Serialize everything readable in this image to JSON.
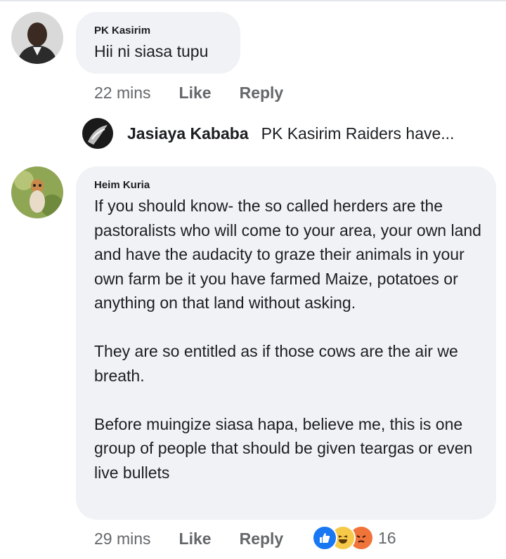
{
  "comments": [
    {
      "author": "PK Kasirim",
      "text": "Hii ni siasa tupu",
      "time": "22 mins",
      "like_label": "Like",
      "reply_label": "Reply"
    },
    {
      "author": "Heim Kuria",
      "text": "If you should know- the so called herders are the pastoralists who will come to your area, your own land and have the audacity to graze their animals in your own farm be it you have farmed Maize, potatoes or anything on that land without asking.\n\nThey are so entitled as if those cows are the air we breath.\n\nBefore muingize siasa hapa, believe me, this is one group of people that should be given teargas or even live bullets",
      "time": "29 mins",
      "like_label": "Like",
      "reply_label": "Reply",
      "reaction_count": "16"
    }
  ],
  "reply_preview": {
    "author": "Jasiaya Kababa",
    "text": "PK Kasirim Raiders have..."
  },
  "reaction_icons": [
    "like-icon",
    "haha-icon",
    "angry-icon"
  ],
  "colors": {
    "bubble": "#f0f2f5",
    "secondary_text": "#65676b",
    "like_blue": "#1877f2",
    "angry_orange": "#f0733a",
    "haha_yellow": "#f7c948"
  }
}
